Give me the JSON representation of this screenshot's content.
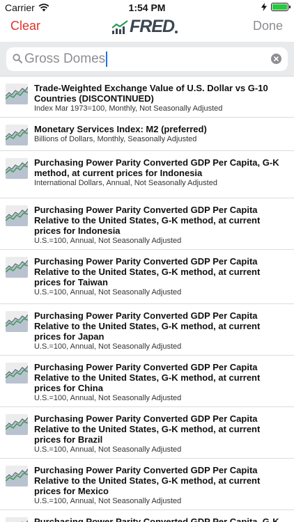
{
  "status_bar": {
    "carrier": "Carrier",
    "time": "1:54 PM",
    "battery_color": "#28c840"
  },
  "nav": {
    "left_label": "Clear",
    "logo_text": "FRED",
    "right_label": "Done",
    "accent_color": "#e0332b"
  },
  "search": {
    "value": "Gross Domes"
  },
  "results": [
    {
      "title": "Trade-Weighted Exchange Value of U.S. Dollar vs G-10 Countries (DISCONTINUED)",
      "subtitle": "Index Mar 1973=100, Monthly, Not Seasonally Adjusted"
    },
    {
      "title": "Monetary Services Index: M2 (preferred)",
      "subtitle": "Billions of Dollars, Monthly, Seasonally Adjusted"
    },
    {
      "title": "Purchasing Power Parity Converted GDP Per Capita, G-K method, at current prices for Indonesia",
      "subtitle": "International Dollars, Annual, Not Seasonally Adjusted"
    },
    {
      "title": "Purchasing Power Parity Converted GDP Per Capita Relative to the United States, G-K method, at current prices for Indonesia",
      "subtitle": "U.S.=100, Annual, Not Seasonally Adjusted"
    },
    {
      "title": "Purchasing Power Parity Converted GDP Per Capita Relative to the United States, G-K method, at current prices for Taiwan",
      "subtitle": "U.S.=100, Annual, Not Seasonally Adjusted"
    },
    {
      "title": "Purchasing Power Parity Converted GDP Per Capita Relative to the United States, G-K method, at current prices for Japan",
      "subtitle": "U.S.=100, Annual, Not Seasonally Adjusted"
    },
    {
      "title": "Purchasing Power Parity Converted GDP Per Capita Relative to the United States, G-K method, at current prices for China",
      "subtitle": "U.S.=100, Annual, Not Seasonally Adjusted"
    },
    {
      "title": "Purchasing Power Parity Converted GDP Per Capita Relative to the United States, G-K method, at current prices for Brazil",
      "subtitle": "U.S.=100, Annual, Not Seasonally Adjusted"
    },
    {
      "title": "Purchasing Power Parity Converted GDP Per Capita Relative to the United States, G-K method, at current prices for Mexico",
      "subtitle": "U.S.=100, Annual, Not Seasonally Adjusted"
    },
    {
      "title": "Purchasing Power Parity Converted GDP Per Capita, G-K method, at current prices for Haiti",
      "subtitle": ""
    }
  ]
}
